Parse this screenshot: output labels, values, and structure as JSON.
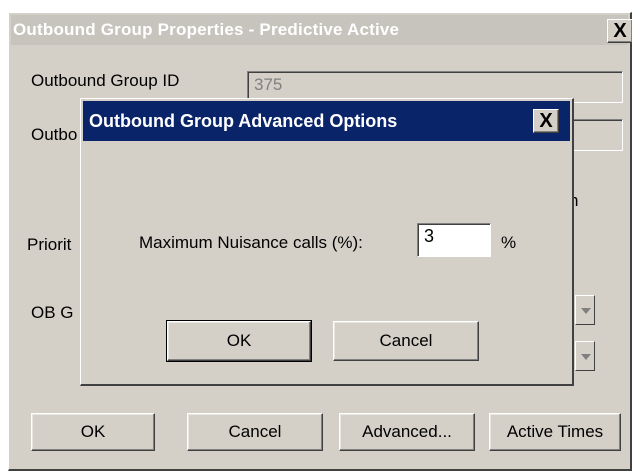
{
  "main_dialog": {
    "title": "Outbound Group Properties - Predictive Active",
    "close_label": "X",
    "group_id_label": "Outbound Group ID",
    "group_id_value": "375",
    "group_name_label": "Outbo",
    "partial_text": "h",
    "priority_label": "Priorit",
    "ob_group_label": "OB G",
    "buttons": {
      "ok": "OK",
      "cancel": "Cancel",
      "advanced": "Advanced...",
      "active_times": "Active Times"
    }
  },
  "advanced_dialog": {
    "title": "Outbound Group Advanced Options",
    "close_label": "X",
    "nuisance_label": "Maximum Nuisance calls (%):",
    "nuisance_value": "3",
    "unit": "%",
    "ok": "OK",
    "cancel": "Cancel"
  },
  "colors": {
    "modal_title_bg": "#0a246a",
    "inactive_title_bg": "#c7c4bd",
    "face": "#d4d0c8"
  }
}
